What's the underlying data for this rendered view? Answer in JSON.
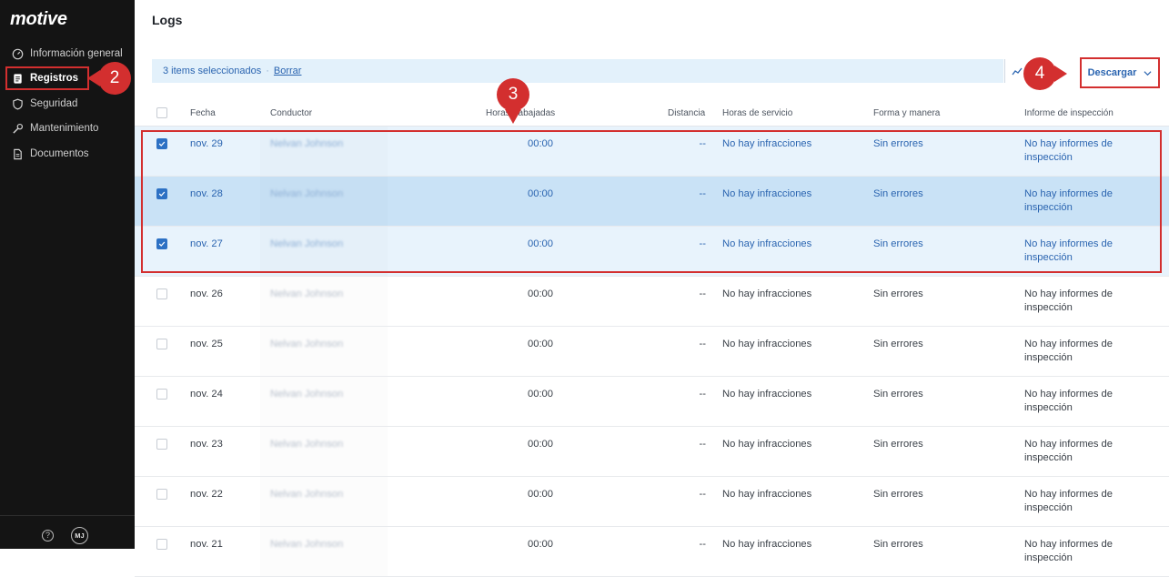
{
  "app": {
    "logo": "motive"
  },
  "sidebar": {
    "items": [
      {
        "label": "Información general",
        "icon": "dashboard-icon",
        "active": false
      },
      {
        "label": "Registros",
        "icon": "document-icon",
        "active": true
      },
      {
        "label": "Seguridad",
        "icon": "shield-icon",
        "active": false
      },
      {
        "label": "Mantenimiento",
        "icon": "wrench-icon",
        "active": false
      },
      {
        "label": "Documentos",
        "icon": "file-icon",
        "active": false
      }
    ],
    "help": "?",
    "avatar": "MJ"
  },
  "page": {
    "title": "Logs"
  },
  "selection": {
    "count_text": "3 items seleccionados",
    "separator": "·",
    "clear_label": "Borrar"
  },
  "toolbar": {
    "download_label": "Descargar"
  },
  "callouts": {
    "c2": "2",
    "c3": "3",
    "c4": "4"
  },
  "table": {
    "columns": [
      "Fecha",
      "Conductor",
      "Horas trabajadas",
      "Distancia",
      "Horas de servicio",
      "Forma y manera",
      "Informe de inspección"
    ],
    "rows": [
      {
        "date": "nov. 29",
        "driver": "Nelvan Johnson",
        "hours": "00:00",
        "distance": "--",
        "hos": "No hay infracciones",
        "form": "Sin errores",
        "report": "No hay informes de inspección",
        "selected": true
      },
      {
        "date": "nov. 28",
        "driver": "Nelvan Johnson",
        "hours": "00:00",
        "distance": "--",
        "hos": "No hay infracciones",
        "form": "Sin errores",
        "report": "No hay informes de inspección",
        "selected": true
      },
      {
        "date": "nov. 27",
        "driver": "Nelvan Johnson",
        "hours": "00:00",
        "distance": "--",
        "hos": "No hay infracciones",
        "form": "Sin errores",
        "report": "No hay informes de inspección",
        "selected": true
      },
      {
        "date": "nov. 26",
        "driver": "Nelvan Johnson",
        "hours": "00:00",
        "distance": "--",
        "hos": "No hay infracciones",
        "form": "Sin errores",
        "report": "No hay informes de inspección",
        "selected": false
      },
      {
        "date": "nov. 25",
        "driver": "Nelvan Johnson",
        "hours": "00:00",
        "distance": "--",
        "hos": "No hay infracciones",
        "form": "Sin errores",
        "report": "No hay informes de inspección",
        "selected": false
      },
      {
        "date": "nov. 24",
        "driver": "Nelvan Johnson",
        "hours": "00:00",
        "distance": "--",
        "hos": "No hay infracciones",
        "form": "Sin errores",
        "report": "No hay informes de inspección",
        "selected": false
      },
      {
        "date": "nov. 23",
        "driver": "Nelvan Johnson",
        "hours": "00:00",
        "distance": "--",
        "hos": "No hay infracciones",
        "form": "Sin errores",
        "report": "No hay informes de inspección",
        "selected": false
      },
      {
        "date": "nov. 22",
        "driver": "Nelvan Johnson",
        "hours": "00:00",
        "distance": "--",
        "hos": "No hay infracciones",
        "form": "Sin errores",
        "report": "No hay informes de inspección",
        "selected": false
      },
      {
        "date": "nov. 21",
        "driver": "Nelvan Johnson",
        "hours": "00:00",
        "distance": "--",
        "hos": "No hay infracciones",
        "form": "Sin errores",
        "report": "No hay informes de inspección",
        "selected": false
      }
    ]
  },
  "colors": {
    "accent": "#2a64b0",
    "annotation": "#d32f2f",
    "sidebar_bg": "#141414",
    "selected_row": "#e8f3fc"
  }
}
